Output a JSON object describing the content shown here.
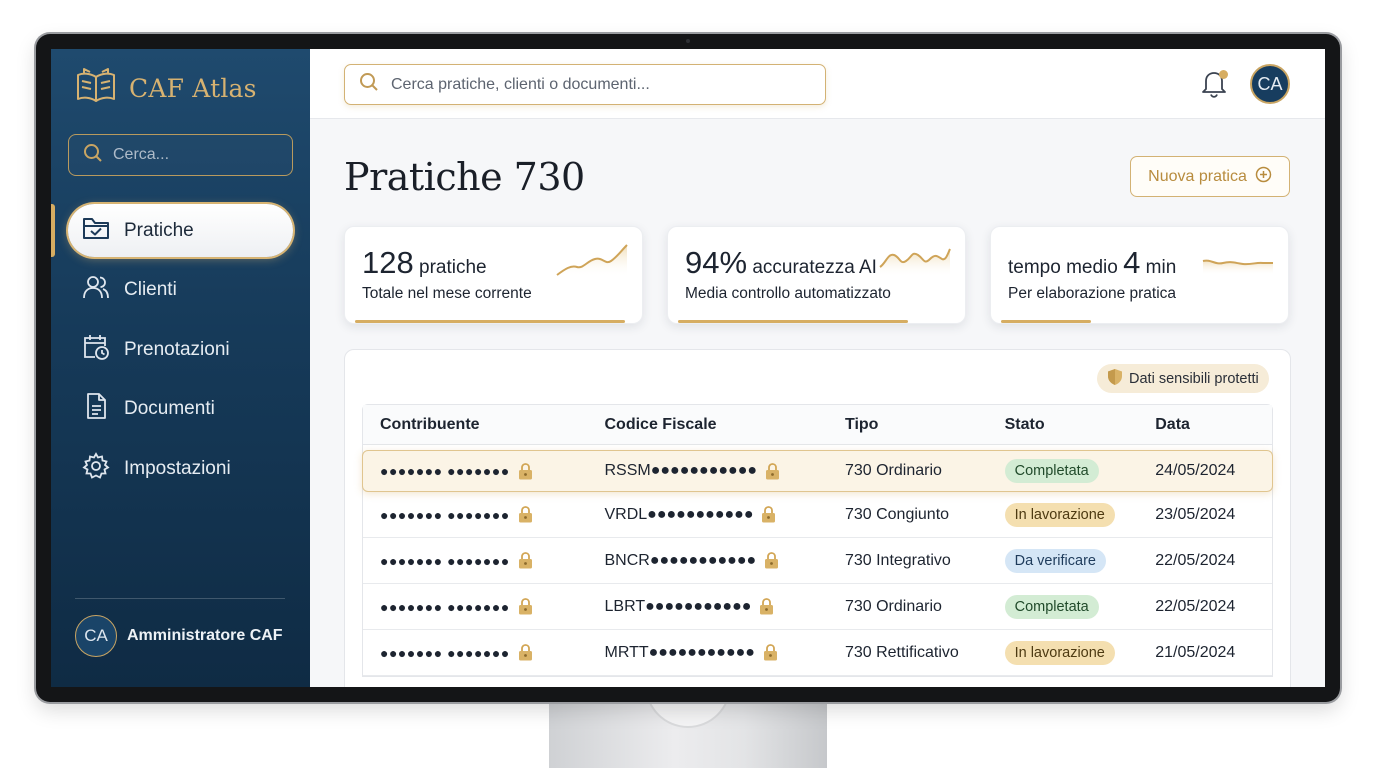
{
  "brand": {
    "name": "CAF Atlas"
  },
  "sidebar": {
    "search_placeholder": "Cerca...",
    "items": [
      {
        "label": "Pratiche",
        "icon": "folder-check-icon",
        "active": true
      },
      {
        "label": "Clienti",
        "icon": "users-icon",
        "active": false
      },
      {
        "label": "Prenotazioni",
        "icon": "calendar-clock-icon",
        "active": false
      },
      {
        "label": "Documenti",
        "icon": "document-icon",
        "active": false
      },
      {
        "label": "Impostazioni",
        "icon": "gear-icon",
        "active": false
      }
    ],
    "user": {
      "initials": "CA",
      "name": "Amministratore CAF"
    }
  },
  "topbar": {
    "search_placeholder": "Cerca pratiche, clienti o documenti...",
    "avatar_initials": "CA",
    "notification_dot": true
  },
  "page": {
    "title": "Pratiche 730",
    "new_button": "Nuova pratica"
  },
  "stats": [
    {
      "value": "128",
      "unit": "pratiche",
      "prefix": "",
      "suffix": "",
      "caption": "Totale nel mese corrente"
    },
    {
      "value": "94%",
      "unit": "accuratezza AI",
      "prefix": "",
      "suffix": "",
      "caption": "Media controllo automatizzato"
    },
    {
      "value": "4",
      "unit": "",
      "prefix": "tempo medio",
      "suffix": "min",
      "caption": "Per elaborazione pratica"
    }
  ],
  "table": {
    "badge": "Dati sensibili protetti",
    "columns": [
      "Contribuente",
      "Codice Fiscale",
      "Tipo",
      "Stato",
      "Data"
    ],
    "rows": [
      {
        "contribuente": "●●●●●●● ●●●●●●●",
        "codice": "RSSM●●●●●●●●●●●",
        "tipo": "730 Ordinario",
        "stato": "Completata",
        "data": "24/05/2024"
      },
      {
        "contribuente": "●●●●●●● ●●●●●●●",
        "codice": "VRDL●●●●●●●●●●●",
        "tipo": "730 Congiunto",
        "stato": "In lavorazione",
        "data": "23/05/2024"
      },
      {
        "contribuente": "●●●●●●● ●●●●●●●",
        "codice": "BNCR●●●●●●●●●●●",
        "tipo": "730 Integrativo",
        "stato": "Da verificare",
        "data": "22/05/2024"
      },
      {
        "contribuente": "●●●●●●● ●●●●●●●",
        "codice": "LBRT●●●●●●●●●●●",
        "tipo": "730 Ordinario",
        "stato": "Completata",
        "data": "22/05/2024"
      },
      {
        "contribuente": "●●●●●●● ●●●●●●●",
        "codice": "MRTT●●●●●●●●●●●",
        "tipo": "730 Rettificativo",
        "stato": "In lavorazione",
        "data": "21/05/2024"
      }
    ]
  },
  "colors": {
    "gold": "#d6ad62",
    "navy": "#163a59",
    "status_completata": "#d3ecd4",
    "status_lavorazione": "#f4dfb0",
    "status_verificare": "#d5e6f6"
  }
}
